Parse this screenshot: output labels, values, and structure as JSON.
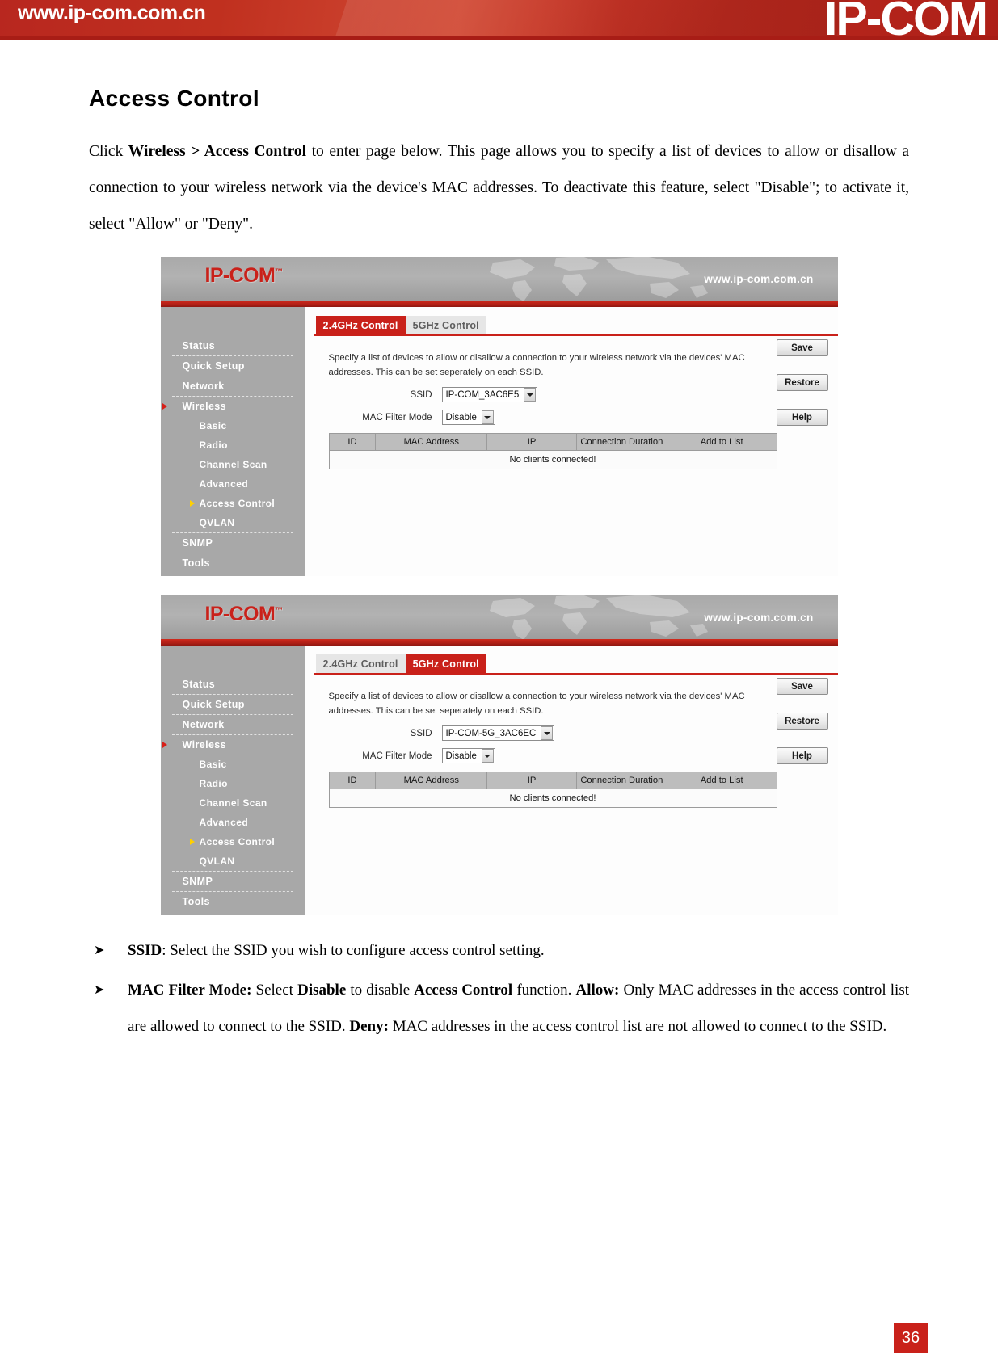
{
  "page_banner": {
    "url": "www.ip-com.com.cn",
    "logo": "IP-COM",
    "brand_red": "#c0301f"
  },
  "document": {
    "title": "Access Control",
    "intro_paragraph": "Click Wireless > Access Control to enter page below. This page allows you to specify a list of devices to allow or disallow a connection to your wireless network via the device's MAC addresses. To deactivate this feature, select \"Disable\"; to activate it, select \"Allow\" or \"Deny\".",
    "intro_parts": {
      "p1": "Click ",
      "bold1": "Wireless > Access Control",
      "p2": " to enter page below. This page allows you to specify a list of devices to allow or disallow a connection to your wireless network via the device's MAC addresses. To deactivate this feature, select \"Disable\"; to activate it, select \"Allow\" or \"Deny\"."
    },
    "page_number": "36"
  },
  "screenshots": [
    {
      "header": {
        "logo": "IP-COM",
        "trademark": "™",
        "url": "www.ip-com.com.cn"
      },
      "sidebar": {
        "items": [
          {
            "label": "Status",
            "level": "top",
            "arrow": "none"
          },
          {
            "label": "Quick Setup",
            "level": "top",
            "arrow": "none"
          },
          {
            "label": "Network",
            "level": "top",
            "arrow": "none"
          },
          {
            "label": "Wireless",
            "level": "top",
            "arrow": "red"
          },
          {
            "label": "Basic",
            "level": "sub",
            "arrow": "none"
          },
          {
            "label": "Radio",
            "level": "sub",
            "arrow": "none"
          },
          {
            "label": "Channel Scan",
            "level": "sub",
            "arrow": "none"
          },
          {
            "label": "Advanced",
            "level": "sub",
            "arrow": "none"
          },
          {
            "label": "Access Control",
            "level": "sub",
            "arrow": "yellow"
          },
          {
            "label": "QVLAN",
            "level": "sub",
            "arrow": "none"
          },
          {
            "label": "SNMP",
            "level": "top",
            "arrow": "none"
          },
          {
            "label": "Tools",
            "level": "top",
            "arrow": "none"
          }
        ]
      },
      "tabs": [
        {
          "label": "2.4GHz Control",
          "active": true
        },
        {
          "label": "5GHz Control",
          "active": false
        }
      ],
      "description": "Specify a list of devices to allow or disallow a connection to your wireless network via the devices' MAC addresses. This can be set seperately on each SSID.",
      "form": {
        "ssid_label": "SSID",
        "ssid_value": "IP-COM_3AC6E5",
        "mac_filter_label": "MAC Filter Mode",
        "mac_filter_value": "Disable"
      },
      "table": {
        "headers": [
          "ID",
          "MAC Address",
          "IP",
          "Connection Duration",
          "Add to List"
        ],
        "empty_message": "No clients connected!",
        "rows": []
      },
      "buttons": [
        "Save",
        "Restore",
        "Help"
      ]
    },
    {
      "header": {
        "logo": "IP-COM",
        "trademark": "™",
        "url": "www.ip-com.com.cn"
      },
      "sidebar": {
        "items": [
          {
            "label": "Status",
            "level": "top",
            "arrow": "none"
          },
          {
            "label": "Quick Setup",
            "level": "top",
            "arrow": "none"
          },
          {
            "label": "Network",
            "level": "top",
            "arrow": "none"
          },
          {
            "label": "Wireless",
            "level": "top",
            "arrow": "red"
          },
          {
            "label": "Basic",
            "level": "sub",
            "arrow": "none"
          },
          {
            "label": "Radio",
            "level": "sub",
            "arrow": "none"
          },
          {
            "label": "Channel Scan",
            "level": "sub",
            "arrow": "none"
          },
          {
            "label": "Advanced",
            "level": "sub",
            "arrow": "none"
          },
          {
            "label": "Access Control",
            "level": "sub",
            "arrow": "yellow"
          },
          {
            "label": "QVLAN",
            "level": "sub",
            "arrow": "none"
          },
          {
            "label": "SNMP",
            "level": "top",
            "arrow": "none"
          },
          {
            "label": "Tools",
            "level": "top",
            "arrow": "none"
          }
        ]
      },
      "tabs": [
        {
          "label": "2.4GHz Control",
          "active": false
        },
        {
          "label": "5GHz Control",
          "active": true
        }
      ],
      "description": "Specify a list of devices to allow or disallow a connection to your wireless network via the devices' MAC addresses. This can be set seperately on each SSID.",
      "form": {
        "ssid_label": "SSID",
        "ssid_value": "IP-COM-5G_3AC6EC",
        "mac_filter_label": "MAC Filter Mode",
        "mac_filter_value": "Disable"
      },
      "table": {
        "headers": [
          "ID",
          "MAC Address",
          "IP",
          "Connection Duration",
          "Add to List"
        ],
        "empty_message": "No clients connected!",
        "rows": []
      },
      "buttons": [
        "Save",
        "Restore",
        "Help"
      ]
    }
  ],
  "bullets": [
    {
      "segments": [
        {
          "text": "SSID",
          "bold": true
        },
        {
          "text": ": Select the SSID you wish to configure access control setting.",
          "bold": false
        }
      ]
    },
    {
      "segments": [
        {
          "text": "MAC Filter Mode:",
          "bold": true
        },
        {
          "text": " Select ",
          "bold": false
        },
        {
          "text": "Disable",
          "bold": true
        },
        {
          "text": " to disable ",
          "bold": false
        },
        {
          "text": "Access Control",
          "bold": true
        },
        {
          "text": " function. ",
          "bold": false
        },
        {
          "text": "Allow:",
          "bold": true
        },
        {
          "text": " Only MAC addresses in the access control list are allowed to connect to the SSID. ",
          "bold": false
        },
        {
          "text": "Deny:",
          "bold": true
        },
        {
          "text": " MAC addresses in the access control list are not allowed to connect to the SSID.",
          "bold": false
        }
      ]
    }
  ]
}
